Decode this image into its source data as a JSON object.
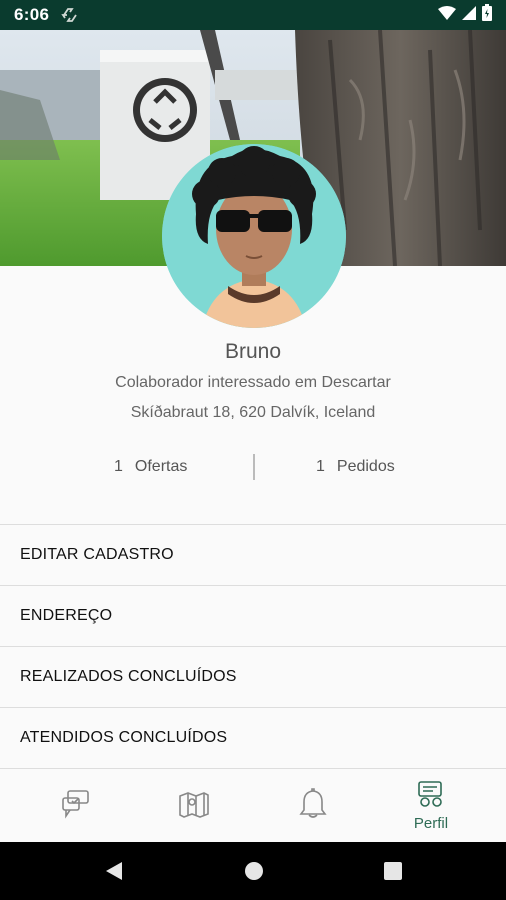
{
  "status_bar": {
    "time": "6:06",
    "icons": [
      "recycle-notification-icon",
      "wifi-icon",
      "signal-icon",
      "battery-icon"
    ]
  },
  "profile": {
    "name": "Bruno",
    "role": "Colaborador interessado em Descartar",
    "address": "Skíðabraut 18, 620 Dalvík, Iceland",
    "stats": {
      "offers_count": "1",
      "offers_label": "Ofertas",
      "orders_count": "1",
      "orders_label": "Pedidos"
    }
  },
  "menu": {
    "items": [
      {
        "label": "EDITAR CADASTRO"
      },
      {
        "label": "ENDEREÇO"
      },
      {
        "label": "REALIZADOS CONCLUÍDOS"
      },
      {
        "label": "ATENDIDOS CONCLUÍDOS"
      }
    ]
  },
  "bottom_nav": {
    "items": [
      {
        "icon": "offers-icon",
        "label": ""
      },
      {
        "icon": "map-icon",
        "label": ""
      },
      {
        "icon": "bell-icon",
        "label": ""
      },
      {
        "icon": "profile-icon",
        "label": "Perfil"
      }
    ]
  },
  "colors": {
    "status_bar": "#0a3b2e",
    "accent": "#2e6b55",
    "avatar_bg": "#7fd9d3"
  }
}
